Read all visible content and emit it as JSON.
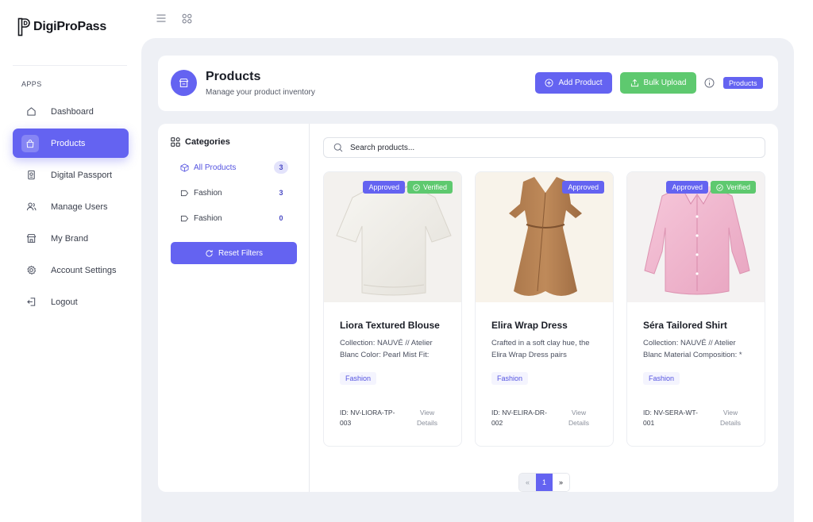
{
  "brand": {
    "name": "DigiProPass"
  },
  "sidebar": {
    "section_label": "APPS",
    "items": [
      {
        "label": "Dashboard",
        "icon": "home-icon",
        "active": false
      },
      {
        "label": "Products",
        "icon": "bag-icon",
        "active": true
      },
      {
        "label": "Digital Passport",
        "icon": "passport-icon",
        "active": false
      },
      {
        "label": "Manage Users",
        "icon": "users-icon",
        "active": false
      },
      {
        "label": "My Brand",
        "icon": "store-icon",
        "active": false
      },
      {
        "label": "Account Settings",
        "icon": "gear-icon",
        "active": false
      },
      {
        "label": "Logout",
        "icon": "logout-icon",
        "active": false
      }
    ]
  },
  "topbar": {
    "icons": [
      "menu-icon",
      "apps-grid-icon"
    ]
  },
  "header": {
    "title": "Products",
    "subtitle": "Manage your product inventory",
    "add_label": "Add Product",
    "bulk_label": "Bulk Upload",
    "badge": "Products"
  },
  "categories": {
    "title": "Categories",
    "items": [
      {
        "label": "All Products",
        "count": "3",
        "active": true
      },
      {
        "label": "Fashion",
        "count": "3",
        "active": false
      },
      {
        "label": "Fashion",
        "count": "0",
        "active": false
      }
    ],
    "reset_label": "Reset Filters"
  },
  "search": {
    "placeholder": "Search products..."
  },
  "products": [
    {
      "name": "Liora Textured Blouse",
      "description": "Collection: NAUVÉ // Atelier Blanc Color: Pearl Mist Fit:",
      "category": "Fashion",
      "id_text": "ID: NV-LIORA-TP-003",
      "view_label": "View Details",
      "badges": [
        "Approved",
        "Verified"
      ]
    },
    {
      "name": "Elira Wrap Dress",
      "description": "Crafted in a soft clay hue, the Elira Wrap Dress pairs",
      "category": "Fashion",
      "id_text": "ID: NV-ELIRA-DR-002",
      "view_label": "View Details",
      "badges": [
        "Approved"
      ]
    },
    {
      "name": "Séra Tailored Shirt",
      "description": "Collection: NAUVÉ // Atelier Blanc Material Composition: *",
      "category": "Fashion",
      "id_text": "ID: NV-SERA-WT-001",
      "view_label": "View Details",
      "badges": [
        "Approved",
        "Verified"
      ]
    }
  ],
  "pagination": {
    "prev": "«",
    "current": "1",
    "next": "»"
  },
  "colors": {
    "primary": "#6463f1",
    "success": "#5ec96f",
    "background": "#eef0f5"
  }
}
